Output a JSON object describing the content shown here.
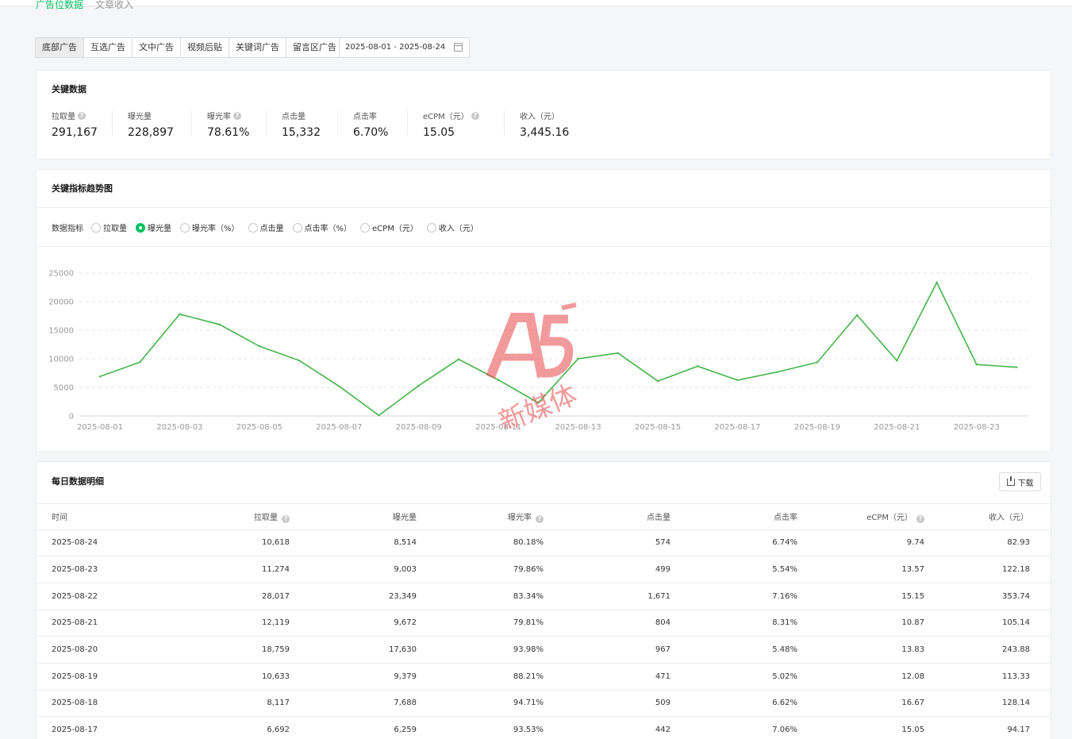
{
  "top_tabs": {
    "active": "广告位数据",
    "inactive": "文章收入"
  },
  "ad_types": [
    "底部广告",
    "互选广告",
    "文中广告",
    "视频后贴",
    "关键词广告",
    "留言区广告"
  ],
  "date_range": "2025-08-01 - 2025-08-24",
  "key_data": {
    "title": "关键数据",
    "metrics": [
      {
        "label": "拉取量",
        "value": "291,167",
        "help": true
      },
      {
        "label": "曝光量",
        "value": "228,897",
        "help": false
      },
      {
        "label": "曝光率",
        "value": "78.61%",
        "help": true
      },
      {
        "label": "点击量",
        "value": "15,332",
        "help": false
      },
      {
        "label": "点击率",
        "value": "6.70%",
        "help": false
      },
      {
        "label": "eCPM（元）",
        "value": "15.05",
        "help": true
      },
      {
        "label": "收入（元）",
        "value": "3,445.16",
        "help": false
      }
    ]
  },
  "trend": {
    "title": "关键指标趋势图",
    "metric_label": "数据指标",
    "options": [
      "拉取量",
      "曝光量",
      "曝光率（%）",
      "点击量",
      "点击率（%）",
      "eCPM（元）",
      "收入（元）"
    ],
    "selected": "曝光量"
  },
  "chart_data": {
    "type": "line",
    "x": [
      "2025-08-01",
      "2025-08-02",
      "2025-08-03",
      "2025-08-04",
      "2025-08-05",
      "2025-08-06",
      "2025-08-07",
      "2025-08-08",
      "2025-08-09",
      "2025-08-10",
      "2025-08-11",
      "2025-08-12",
      "2025-08-13",
      "2025-08-14",
      "2025-08-15",
      "2025-08-16",
      "2025-08-17",
      "2025-08-18",
      "2025-08-19",
      "2025-08-20",
      "2025-08-21",
      "2025-08-22",
      "2025-08-23",
      "2025-08-24"
    ],
    "x_tick_labels": [
      "2025-08-01",
      "2025-08-03",
      "2025-08-05",
      "2025-08-07",
      "2025-08-09",
      "2025-08-11",
      "2025-08-13",
      "2025-08-15",
      "2025-08-17",
      "2025-08-19",
      "2025-08-21",
      "2025-08-23"
    ],
    "series": [
      {
        "values": [
          6900,
          9400,
          17800,
          16000,
          12200,
          9700,
          5200,
          100,
          5300,
          9900,
          6300,
          2300,
          10000,
          11000,
          6100,
          8700,
          6259,
          7688,
          9379,
          17630,
          9672,
          23349,
          9003,
          8514
        ]
      }
    ],
    "yticks": [
      0,
      5000,
      10000,
      15000,
      20000,
      25000
    ],
    "ylim": [
      0,
      25000
    ],
    "grid": true,
    "line_color": "#44b549"
  },
  "daily": {
    "title": "每日数据明细",
    "download_label": "下载",
    "columns": [
      {
        "label": "时间",
        "help": false
      },
      {
        "label": "拉取量",
        "help": true
      },
      {
        "label": "曝光量",
        "help": false
      },
      {
        "label": "曝光率",
        "help": true
      },
      {
        "label": "点击量",
        "help": false
      },
      {
        "label": "点击率",
        "help": false
      },
      {
        "label": "eCPM（元）",
        "help": true
      },
      {
        "label": "收入（元）",
        "help": false
      }
    ],
    "rows": [
      [
        "2025-08-24",
        "10,618",
        "8,514",
        "80.18%",
        "574",
        "6.74%",
        "9.74",
        "82.93"
      ],
      [
        "2025-08-23",
        "11,274",
        "9,003",
        "79.86%",
        "499",
        "5.54%",
        "13.57",
        "122.18"
      ],
      [
        "2025-08-22",
        "28,017",
        "23,349",
        "83.34%",
        "1,671",
        "7.16%",
        "15.15",
        "353.74"
      ],
      [
        "2025-08-21",
        "12,119",
        "9,672",
        "79.81%",
        "804",
        "8.31%",
        "10.87",
        "105.14"
      ],
      [
        "2025-08-20",
        "18,759",
        "17,630",
        "93.98%",
        "967",
        "5.48%",
        "13.83",
        "243.88"
      ],
      [
        "2025-08-19",
        "10,633",
        "9,379",
        "88.21%",
        "471",
        "5.02%",
        "12.08",
        "113.33"
      ],
      [
        "2025-08-18",
        "8,117",
        "7,688",
        "94.71%",
        "509",
        "6.62%",
        "16.67",
        "128.14"
      ],
      [
        "2025-08-17",
        "6,692",
        "6,259",
        "93.53%",
        "442",
        "7.06%",
        "15.05",
        "94.17"
      ]
    ]
  },
  "watermark": {
    "logo": "A5",
    "text": "新媒体"
  }
}
